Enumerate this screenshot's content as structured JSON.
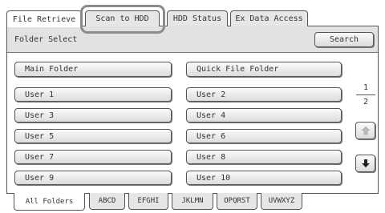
{
  "top_tabs": {
    "file_retrieve": "File Retrieve",
    "scan_to_hdd": "Scan to HDD",
    "hdd_status": "HDD Status",
    "ex_data_access": "Ex Data Access"
  },
  "header": {
    "title": "Folder Select",
    "search_label": "Search"
  },
  "folders": {
    "main": "Main Folder",
    "quick": "Quick File Folder",
    "users": [
      "User 1",
      "User 2",
      "User 3",
      "User 4",
      "User 5",
      "User 6",
      "User 7",
      "User 8",
      "User 9",
      "User 10"
    ]
  },
  "pager": {
    "current_page": "1",
    "total_pages": "2",
    "up_icon": "arrow-up-icon",
    "down_icon": "arrow-down-icon"
  },
  "bottom_tabs": {
    "all": "All Folders",
    "abcd": "ABCD",
    "efghi": "EFGHI",
    "jklmn": "JKLMN",
    "opqrst": "OPQRST",
    "uvwxyz": "UVWXYZ"
  },
  "colors": {
    "highlight_ring": "#8c8c8c",
    "bar_background": "#e2e2e2"
  }
}
